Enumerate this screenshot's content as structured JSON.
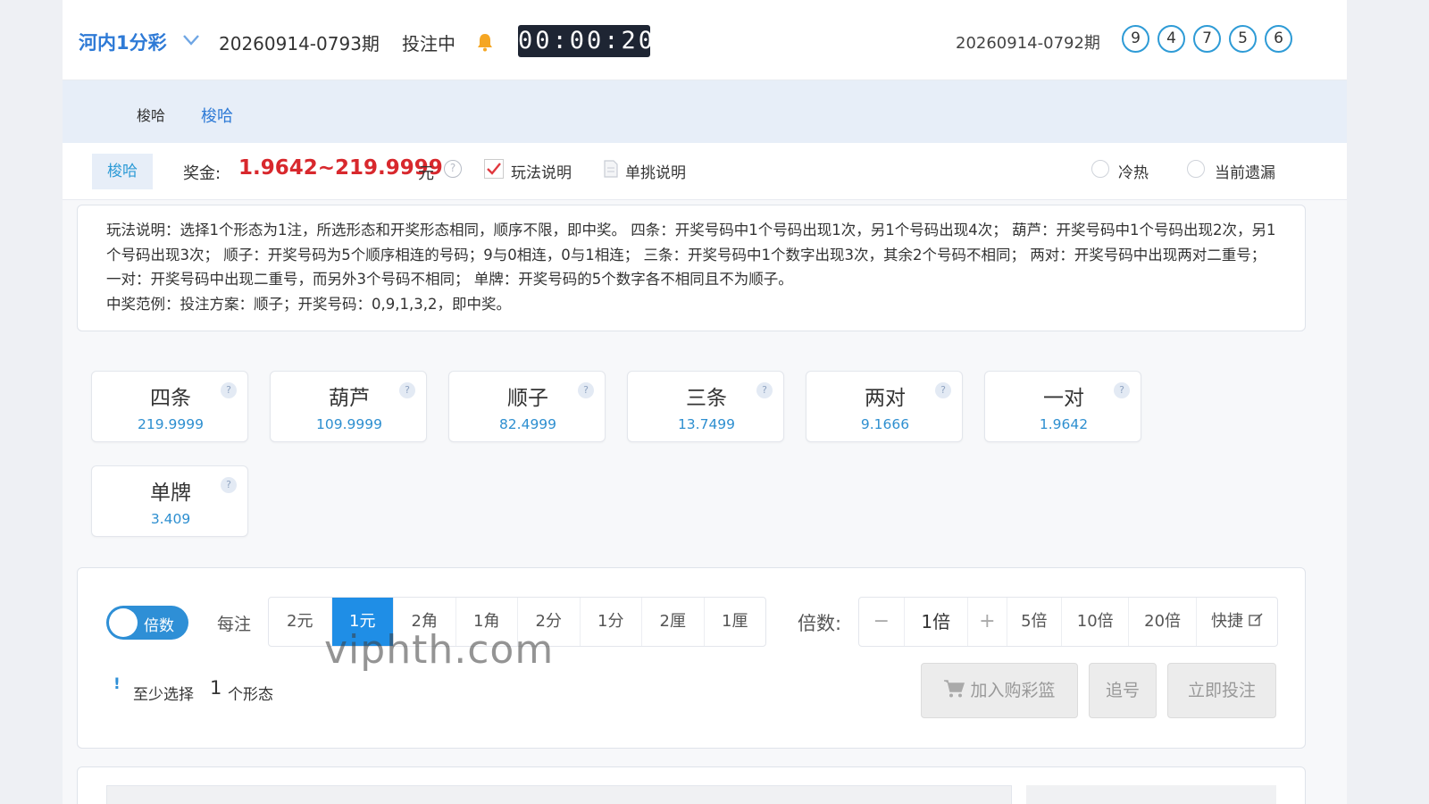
{
  "header": {
    "game_name": "河内1分彩",
    "period": "20260914-0793期",
    "status": "投注中",
    "countdown": "00:00:20",
    "last_period": "20260914-0792期",
    "last_numbers": [
      "9",
      "4",
      "7",
      "5",
      "6"
    ],
    "accent_color": "#2e7ad6",
    "ball_border_color": "#2e9bd6"
  },
  "tabs": {
    "items": [
      {
        "label": "梭哈",
        "active": false
      },
      {
        "label": "梭哈",
        "active": true
      }
    ]
  },
  "infobar": {
    "subtab": "梭哈",
    "prize_label": "奖金:",
    "prize_value": "1.9642~219.9999",
    "prize_unit": "元",
    "help_icon": "question-circle-icon",
    "rules_toggle_label": "玩法说明",
    "rules_toggle_checked": true,
    "single_label": "单挑说明",
    "radio_hotcold": "冷热",
    "radio_missing": "当前遗漏",
    "prize_color": "#d8282d"
  },
  "rules": {
    "text": "玩法说明：选择1个形态为1注，所选形态和开奖形态相同，顺序不限，即中奖。 四条：开奖号码中1个号码出现1次，另1个号码出现4次； 葫芦：开奖号码中1个号码出现2次，另1个号码出现3次； 顺子：开奖号码为5个顺序相连的号码；9与0相连，0与1相连； 三条：开奖号码中1个数字出现3次，其余2个号码不相同； 两对：开奖号码中出现两对二重号； 一对：开奖号码中出现二重号，而另外3个号码不相同； 单牌：开奖号码的5个数字各不相同且不为顺子。",
    "example": "中奖范例：投注方案：顺子；开奖号码：0,9,1,3,2，即中奖。"
  },
  "shapes": [
    {
      "name": "四条",
      "odds": "219.9999"
    },
    {
      "name": "葫芦",
      "odds": "109.9999"
    },
    {
      "name": "顺子",
      "odds": "82.4999"
    },
    {
      "name": "三条",
      "odds": "13.7499"
    },
    {
      "name": "两对",
      "odds": "9.1666"
    },
    {
      "name": "一对",
      "odds": "1.9642"
    },
    {
      "name": "单牌",
      "odds": "3.409"
    }
  ],
  "bet": {
    "toggle_label": "倍数",
    "toggle_on": true,
    "per_label": "每注",
    "units": [
      "2元",
      "1元",
      "2角",
      "1角",
      "2分",
      "1分",
      "2厘",
      "1厘"
    ],
    "active_unit": "1元",
    "multiplier_label": "倍数:",
    "minus_label": "−",
    "multiplier_value": "1倍",
    "plus_label": "+",
    "presets": [
      "5倍",
      "10倍",
      "20倍"
    ],
    "quick_label": "快捷",
    "hint_prefix": "至少选择",
    "hint_count": "1",
    "hint_suffix": "个形态",
    "add_cart_label": "加入购彩篮",
    "chase_label": "追号",
    "bet_now_label": "立即投注",
    "active_color": "#1f8ee6"
  },
  "watermark": "viphth.com"
}
